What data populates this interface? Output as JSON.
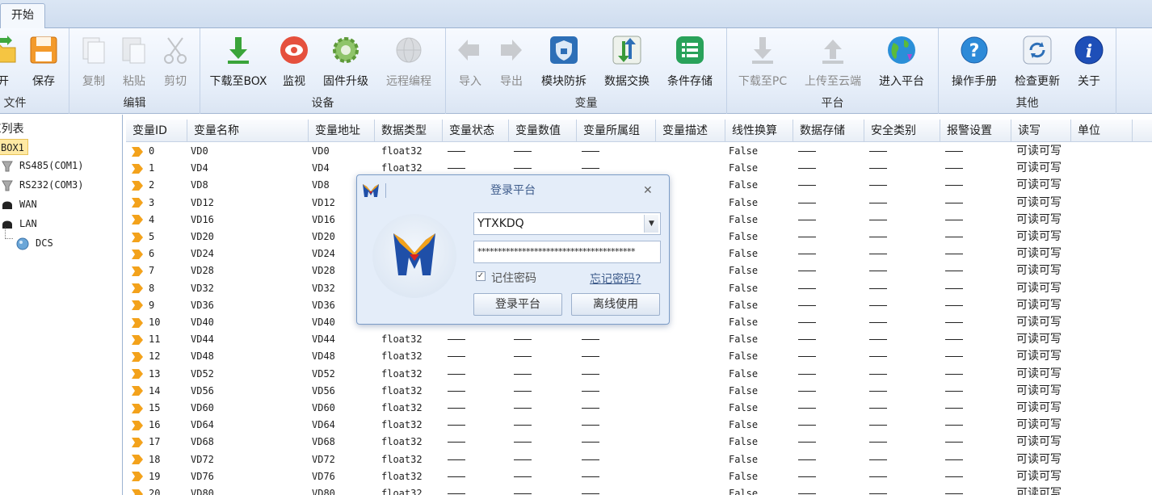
{
  "ribbon": {
    "tab": "开始",
    "groups": [
      {
        "label": "文件",
        "buttons": [
          "开",
          "保存"
        ]
      },
      {
        "label": "编辑",
        "buttons": [
          "复制",
          "粘贴",
          "剪切"
        ]
      },
      {
        "label": "设备",
        "buttons": [
          "下载至BOX",
          "监视",
          "固件升级",
          "远程编程"
        ]
      },
      {
        "label": "变量",
        "buttons": [
          "导入",
          "导出",
          "模块防拆",
          "数据交换",
          "条件存储"
        ]
      },
      {
        "label": "平台",
        "buttons": [
          "下载至PC",
          "上传至云端",
          "进入平台"
        ]
      },
      {
        "label": "其他",
        "buttons": [
          "操作手册",
          "检查更新",
          "关于"
        ]
      }
    ]
  },
  "tree": {
    "title": "X列表",
    "nodes": [
      "BOX1",
      "RS485(COM1)",
      "RS232(COM3)",
      "WAN",
      "LAN",
      "DCS"
    ]
  },
  "grid": {
    "columns": [
      "变量ID",
      "变量名称",
      "变量地址",
      "数据类型",
      "变量状态",
      "变量数值",
      "变量所属组",
      "变量描述",
      "线性换算",
      "数据存储",
      "安全类别",
      "报警设置",
      "读写",
      "单位"
    ],
    "rows": [
      {
        "id": "0",
        "name": "VD0",
        "addr": "VD0",
        "type": "float32",
        "linear": "False",
        "rw": "可读可写"
      },
      {
        "id": "1",
        "name": "VD4",
        "addr": "VD4",
        "type": "float32",
        "linear": "False",
        "rw": "可读可写"
      },
      {
        "id": "2",
        "name": "VD8",
        "addr": "VD8",
        "type": "",
        "linear": "False",
        "rw": "可读可写"
      },
      {
        "id": "3",
        "name": "VD12",
        "addr": "VD12",
        "type": "",
        "linear": "False",
        "rw": "可读可写"
      },
      {
        "id": "4",
        "name": "VD16",
        "addr": "VD16",
        "type": "",
        "linear": "False",
        "rw": "可读可写"
      },
      {
        "id": "5",
        "name": "VD20",
        "addr": "VD20",
        "type": "",
        "linear": "False",
        "rw": "可读可写"
      },
      {
        "id": "6",
        "name": "VD24",
        "addr": "VD24",
        "type": "",
        "linear": "False",
        "rw": "可读可写"
      },
      {
        "id": "7",
        "name": "VD28",
        "addr": "VD28",
        "type": "",
        "linear": "False",
        "rw": "可读可写"
      },
      {
        "id": "8",
        "name": "VD32",
        "addr": "VD32",
        "type": "",
        "linear": "False",
        "rw": "可读可写"
      },
      {
        "id": "9",
        "name": "VD36",
        "addr": "VD36",
        "type": "",
        "linear": "False",
        "rw": "可读可写"
      },
      {
        "id": "10",
        "name": "VD40",
        "addr": "VD40",
        "type": "",
        "linear": "False",
        "rw": "可读可写"
      },
      {
        "id": "11",
        "name": "VD44",
        "addr": "VD44",
        "type": "float32",
        "linear": "False",
        "rw": "可读可写"
      },
      {
        "id": "12",
        "name": "VD48",
        "addr": "VD48",
        "type": "float32",
        "linear": "False",
        "rw": "可读可写"
      },
      {
        "id": "13",
        "name": "VD52",
        "addr": "VD52",
        "type": "float32",
        "linear": "False",
        "rw": "可读可写"
      },
      {
        "id": "14",
        "name": "VD56",
        "addr": "VD56",
        "type": "float32",
        "linear": "False",
        "rw": "可读可写"
      },
      {
        "id": "15",
        "name": "VD60",
        "addr": "VD60",
        "type": "float32",
        "linear": "False",
        "rw": "可读可写"
      },
      {
        "id": "16",
        "name": "VD64",
        "addr": "VD64",
        "type": "float32",
        "linear": "False",
        "rw": "可读可写"
      },
      {
        "id": "17",
        "name": "VD68",
        "addr": "VD68",
        "type": "float32",
        "linear": "False",
        "rw": "可读可写"
      },
      {
        "id": "18",
        "name": "VD72",
        "addr": "VD72",
        "type": "float32",
        "linear": "False",
        "rw": "可读可写"
      },
      {
        "id": "19",
        "name": "VD76",
        "addr": "VD76",
        "type": "float32",
        "linear": "False",
        "rw": "可读可写"
      },
      {
        "id": "20",
        "name": "VD80",
        "addr": "VD80",
        "type": "float32",
        "linear": "False",
        "rw": "可读可写"
      }
    ]
  },
  "dialog": {
    "title": "登录平台",
    "username": "YTXKDQ",
    "password": "***************************************",
    "remember_label": "记住密码",
    "remember_checked": "✓",
    "forgot_label": "忘记密码?",
    "login_button": "登录平台",
    "offline_button": "离线使用",
    "close_glyph": "✕"
  }
}
